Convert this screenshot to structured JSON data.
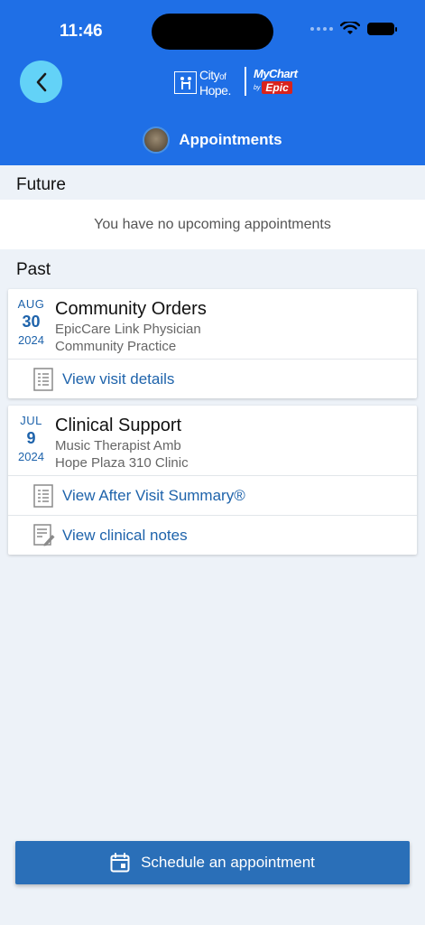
{
  "status_bar": {
    "time": "11:46"
  },
  "header": {
    "logo_city_of": "City",
    "logo_of": "of",
    "logo_hope": "Hope.",
    "logo_mychart": "MyChart",
    "logo_by": "by",
    "logo_epic": "Epic",
    "title": "Appointments"
  },
  "future": {
    "label": "Future",
    "empty_text": "You have no upcoming appointments"
  },
  "past": {
    "label": "Past",
    "appointments": [
      {
        "month": "AUG",
        "day": "30",
        "year": "2024",
        "title": "Community Orders",
        "line1": "EpicCare Link Physician",
        "line2": "Community Practice",
        "links": [
          {
            "label": "View visit details",
            "icon": "document-icon"
          }
        ]
      },
      {
        "month": "JUL",
        "day": "9",
        "year": "2024",
        "title": "Clinical Support",
        "line1": "Music Therapist Amb",
        "line2": "Hope Plaza 310 Clinic",
        "links": [
          {
            "label": "View After Visit Summary®",
            "icon": "document-icon"
          },
          {
            "label": "View clinical notes",
            "icon": "note-edit-icon"
          }
        ]
      }
    ]
  },
  "schedule_button": {
    "label": "Schedule an appointment",
    "icon": "calendar-icon"
  },
  "colors": {
    "header": "#1f6fe6",
    "link": "#1e63ab",
    "button": "#2a6fb8",
    "back": "#63d2f7"
  }
}
